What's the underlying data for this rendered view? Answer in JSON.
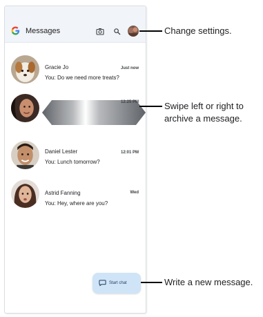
{
  "app": {
    "title": "Messages",
    "logo": "G",
    "icons": [
      "camera-icon",
      "search-icon",
      "profile-avatar"
    ]
  },
  "conversations": [
    {
      "name": "Gracie Jo",
      "preview": "You: Do we need more treats?",
      "time": "Just now",
      "avatar": "dog-avatar"
    },
    {
      "name": "",
      "preview": "",
      "time": "12:25 PM",
      "avatar": "woman-avatar",
      "state": "swiping"
    },
    {
      "name": "Daniel Lester",
      "preview": "You: Lunch tomorrow?",
      "time": "12:01 PM",
      "avatar": "man-avatar"
    },
    {
      "name": "Astrid Fanning",
      "preview": "You: Hey, where are you?",
      "time": "Wed",
      "avatar": "woman2-avatar"
    }
  ],
  "fab": {
    "label": "Start chat",
    "icon": "chat-bubble-icon"
  },
  "callouts": {
    "settings": "Change settings.",
    "swipe_line1": "Swipe left or right to",
    "swipe_line2": "archive a message.",
    "new_message": "Write a new message."
  },
  "colors": {
    "appbar": "#f1f4f8",
    "fab": "#cfe4f7",
    "google_blue": "#4285f4",
    "google_red": "#ea4335",
    "google_yellow": "#fbbc05",
    "google_green": "#34a853"
  }
}
